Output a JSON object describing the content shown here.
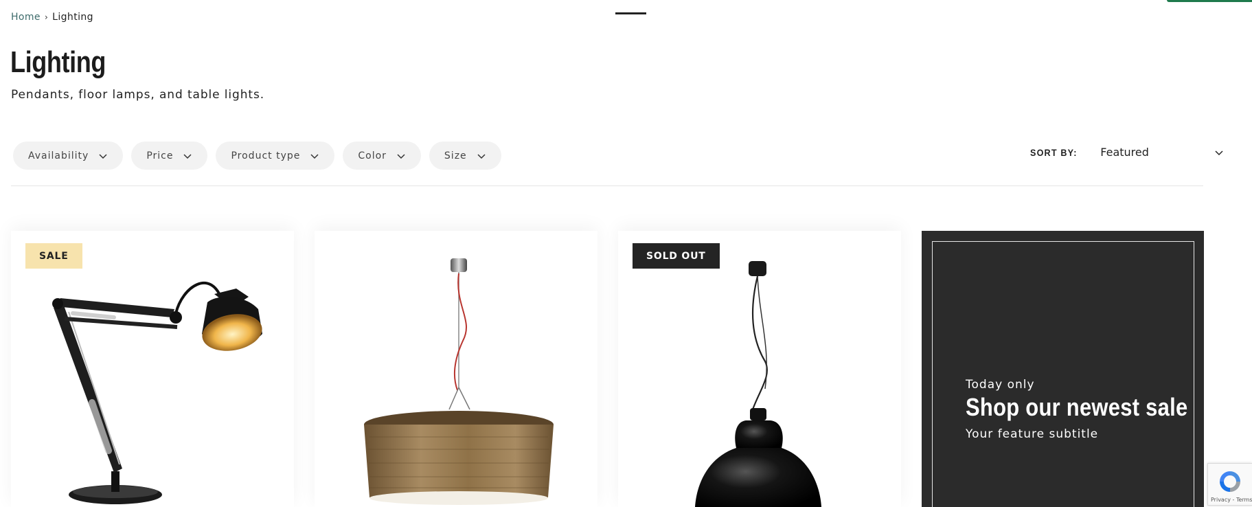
{
  "breadcrumb": {
    "home": "Home",
    "separator": "›",
    "current": "Lighting"
  },
  "collection": {
    "title": "Lighting",
    "description": "Pendants, floor lamps, and table lights."
  },
  "filters": [
    {
      "label": "Availability",
      "icon": "chevron-down-icon"
    },
    {
      "label": "Price",
      "icon": "chevron-down-icon"
    },
    {
      "label": "Product type",
      "icon": "chevron-down-icon"
    },
    {
      "label": "Color",
      "icon": "chevron-down-icon"
    },
    {
      "label": "Size",
      "icon": "chevron-down-icon"
    }
  ],
  "sort": {
    "label": "SORT BY:",
    "selected": "Featured"
  },
  "products": [
    {
      "badge": "SALE",
      "badge_color": "#f7e3ad",
      "image": "desk-lamp-image"
    },
    {
      "badge": "",
      "image": "wood-pendant-lamp-image"
    },
    {
      "badge": "SOLD OUT",
      "badge_color": "#242424",
      "image": "black-pendant-lamp-image"
    }
  ],
  "promo": {
    "eyebrow": "Today only",
    "title": "Shop our newest sale",
    "subtitle": "Your feature subtitle",
    "background": "#2b2b2b"
  },
  "recaptcha": {
    "text": "Privacy - Terms"
  },
  "colors": {
    "accent_green": "#1f7a4d",
    "breadcrumb_link": "#3d6b6b",
    "pill_bg": "#f2f2f2"
  }
}
